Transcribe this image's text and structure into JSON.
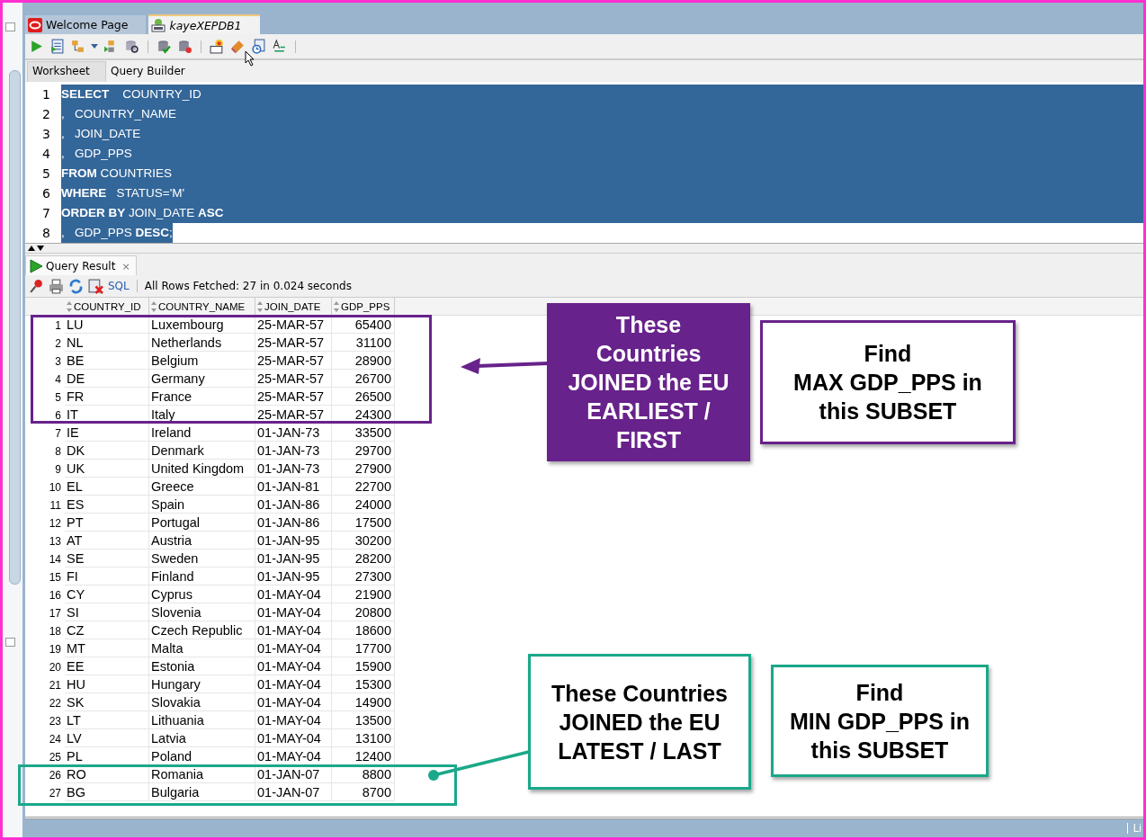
{
  "document_tabs": [
    {
      "label": "Welcome Page",
      "selected": false,
      "kind": "welcome"
    },
    {
      "label": "kayeXEPDB1",
      "selected": true,
      "kind": "sql"
    }
  ],
  "editor_tabs": [
    {
      "label": "Worksheet",
      "selected": true
    },
    {
      "label": "Query Builder",
      "selected": false
    }
  ],
  "editor_lines": [
    {
      "number": "1",
      "text": "**SELECT**    COUNTRY_ID",
      "selected": true,
      "selected_to_edge": true
    },
    {
      "number": "2",
      "text": ",   COUNTRY_NAME",
      "selected": true,
      "selected_to_edge": true
    },
    {
      "number": "3",
      "text": ",   JOIN_DATE",
      "selected": true,
      "selected_to_edge": true
    },
    {
      "number": "4",
      "text": ",   GDP_PPS",
      "selected": true,
      "selected_to_edge": true
    },
    {
      "number": "5",
      "text": "**FROM** COUNTRIES",
      "selected": true,
      "selected_to_edge": true
    },
    {
      "number": "6",
      "text": "**WHERE**   STATUS='M'",
      "selected": true,
      "selected_to_edge": true
    },
    {
      "number": "7",
      "text": "**ORDER BY** JOIN_DATE **ASC**",
      "selected": true,
      "selected_to_edge": true
    },
    {
      "number": "8",
      "text": ",   GDP_PPS **DESC**;",
      "selected": true,
      "selected_to_edge": false
    }
  ],
  "result_tab": {
    "label": "Query Result",
    "close": "×"
  },
  "result_toolbar": {
    "sql_link": "SQL",
    "status": "All Rows Fetched: 27 in 0.024 seconds"
  },
  "table": {
    "columns": [
      "COUNTRY_ID",
      "COUNTRY_NAME",
      "JOIN_DATE",
      "GDP_PPS"
    ],
    "rows": [
      {
        "n": "1",
        "id": "LU",
        "name": "Luxembourg",
        "date": "25-MAR-57",
        "gdp": "65400"
      },
      {
        "n": "2",
        "id": "NL",
        "name": "Netherlands",
        "date": "25-MAR-57",
        "gdp": "31100"
      },
      {
        "n": "3",
        "id": "BE",
        "name": "Belgium",
        "date": "25-MAR-57",
        "gdp": "28900"
      },
      {
        "n": "4",
        "id": "DE",
        "name": "Germany",
        "date": "25-MAR-57",
        "gdp": "26700"
      },
      {
        "n": "5",
        "id": "FR",
        "name": "France",
        "date": "25-MAR-57",
        "gdp": "26500"
      },
      {
        "n": "6",
        "id": "IT",
        "name": "Italy",
        "date": "25-MAR-57",
        "gdp": "24300"
      },
      {
        "n": "7",
        "id": "IE",
        "name": "Ireland",
        "date": "01-JAN-73",
        "gdp": "33500"
      },
      {
        "n": "8",
        "id": "DK",
        "name": "Denmark",
        "date": "01-JAN-73",
        "gdp": "29700"
      },
      {
        "n": "9",
        "id": "UK",
        "name": "United Kingdom",
        "date": "01-JAN-73",
        "gdp": "27900"
      },
      {
        "n": "10",
        "id": "EL",
        "name": "Greece",
        "date": "01-JAN-81",
        "gdp": "22700"
      },
      {
        "n": "11",
        "id": "ES",
        "name": "Spain",
        "date": "01-JAN-86",
        "gdp": "24000"
      },
      {
        "n": "12",
        "id": "PT",
        "name": "Portugal",
        "date": "01-JAN-86",
        "gdp": "17500"
      },
      {
        "n": "13",
        "id": "AT",
        "name": "Austria",
        "date": "01-JAN-95",
        "gdp": "30200"
      },
      {
        "n": "14",
        "id": "SE",
        "name": "Sweden",
        "date": "01-JAN-95",
        "gdp": "28200"
      },
      {
        "n": "15",
        "id": "FI",
        "name": "Finland",
        "date": "01-JAN-95",
        "gdp": "27300"
      },
      {
        "n": "16",
        "id": "CY",
        "name": "Cyprus",
        "date": "01-MAY-04",
        "gdp": "21900"
      },
      {
        "n": "17",
        "id": "SI",
        "name": "Slovenia",
        "date": "01-MAY-04",
        "gdp": "20800"
      },
      {
        "n": "18",
        "id": "CZ",
        "name": "Czech Republic",
        "date": "01-MAY-04",
        "gdp": "18600"
      },
      {
        "n": "19",
        "id": "MT",
        "name": "Malta",
        "date": "01-MAY-04",
        "gdp": "17700"
      },
      {
        "n": "20",
        "id": "EE",
        "name": "Estonia",
        "date": "01-MAY-04",
        "gdp": "15900"
      },
      {
        "n": "21",
        "id": "HU",
        "name": "Hungary",
        "date": "01-MAY-04",
        "gdp": "15300"
      },
      {
        "n": "22",
        "id": "SK",
        "name": "Slovakia",
        "date": "01-MAY-04",
        "gdp": "14900"
      },
      {
        "n": "23",
        "id": "LT",
        "name": "Lithuania",
        "date": "01-MAY-04",
        "gdp": "13500"
      },
      {
        "n": "24",
        "id": "LV",
        "name": "Latvia",
        "date": "01-MAY-04",
        "gdp": "13100"
      },
      {
        "n": "25",
        "id": "PL",
        "name": "Poland",
        "date": "01-MAY-04",
        "gdp": "12400"
      },
      {
        "n": "26",
        "id": "RO",
        "name": "Romania",
        "date": "01-JAN-07",
        "gdp": "8800"
      },
      {
        "n": "27",
        "id": "BG",
        "name": "Bulgaria",
        "date": "01-JAN-07",
        "gdp": "8700"
      }
    ]
  },
  "annotations": [
    {
      "kind": "filled",
      "color": "#68228b",
      "lines": [
        "These",
        "Countries",
        "JOINED the EU",
        "EARLIEST /",
        "FIRST"
      ]
    },
    {
      "kind": "outlined",
      "color": "#68228b",
      "lines": [
        "Find",
        "MAX GDP_PPS in",
        "this SUBSET"
      ]
    },
    {
      "kind": "outlined",
      "color": "#1aa88a",
      "lines": [
        "These Countries",
        "JOINED the EU",
        "LATEST / LAST"
      ]
    },
    {
      "kind": "outlined",
      "color": "#1aa88a",
      "lines": [
        "Find",
        "MIN GDP_PPS in",
        "this SUBSET"
      ]
    }
  ],
  "status_bar": {
    "text": "Li"
  }
}
